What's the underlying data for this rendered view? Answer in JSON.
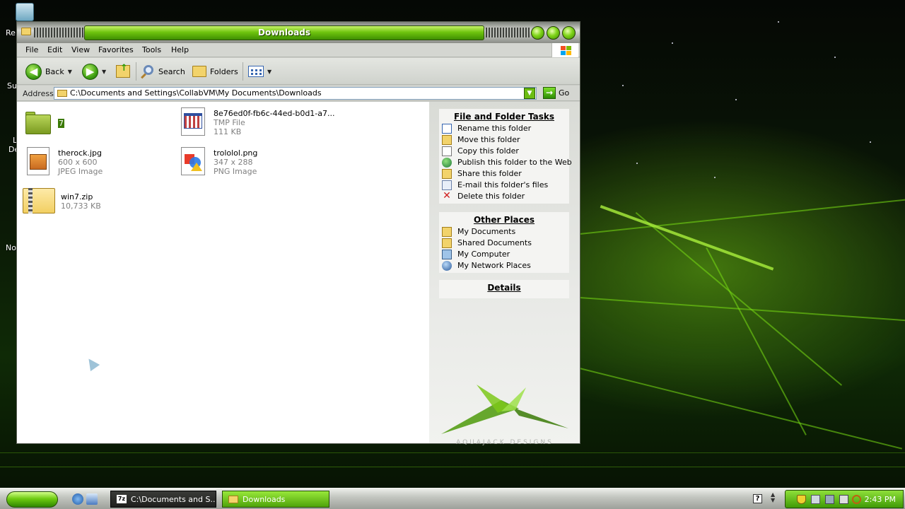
{
  "window": {
    "title": "Downloads"
  },
  "menu": [
    "File",
    "Edit",
    "View",
    "Favorites",
    "Tools",
    "Help"
  ],
  "toolbar": {
    "back_label": "Back",
    "search_label": "Search",
    "folders_label": "Folders"
  },
  "address": {
    "label": "Address",
    "path": "C:\\Documents and Settings\\CollabVM\\My Documents\\Downloads",
    "go_label": "Go"
  },
  "files": [
    {
      "name": "7",
      "line2": "",
      "line3": "",
      "icon": "folder-icon"
    },
    {
      "name": "8e76ed0f-fb6c-44ed-b0d1-a7...",
      "line2": "TMP File",
      "line3": "111 KB",
      "icon": "tmp-file-icon"
    },
    {
      "name": "therock.jpg",
      "line2": "600 x 600",
      "line3": "JPEG Image",
      "icon": "jpeg-image-icon"
    },
    {
      "name": "trololol.png",
      "line2": "347 x 288",
      "line3": "PNG Image",
      "icon": "png-image-icon"
    },
    {
      "name": "win7.zip",
      "line2": "10,733 KB",
      "line3": "",
      "icon": "zip-folder-icon"
    }
  ],
  "tasks": {
    "title": "File and Folder Tasks",
    "items": [
      "Rename this folder",
      "Move this folder",
      "Copy this folder",
      "Publish this folder to the Web",
      "Share this folder",
      "E-mail this folder's files",
      "Delete this folder"
    ]
  },
  "other_places": {
    "title": "Other Places",
    "items": [
      "My Documents",
      "Shared Documents",
      "My Computer",
      "My Network Places"
    ]
  },
  "details": {
    "title": "Details"
  },
  "watermark": {
    "text": "AQUAJACK DESIGNS"
  },
  "desktop": {
    "icon_labels": [
      "Re",
      "Su",
      "L",
      "De",
      "No"
    ]
  },
  "taskbar": {
    "task1_label": "C:\\Documents and S...",
    "task2_label": "Downloads",
    "clock": "2:43 PM"
  },
  "colors": {
    "accent_green": "#6fc40e",
    "chrome_gray": "#c9cbc6",
    "link_blue": "#215dc6"
  }
}
